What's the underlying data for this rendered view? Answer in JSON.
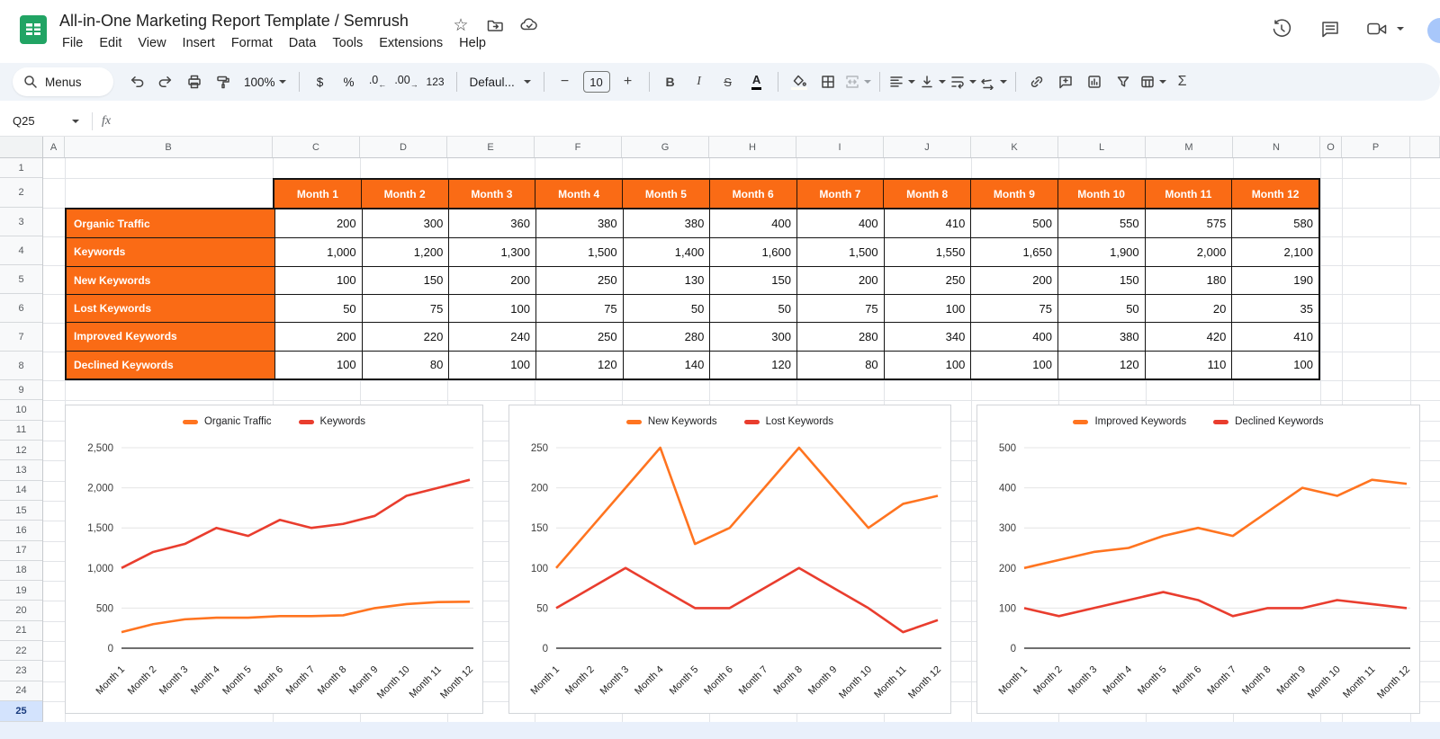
{
  "titlebar": {
    "title": "All-in-One Marketing Report Template / Semrush",
    "menus": [
      "File",
      "Edit",
      "View",
      "Insert",
      "Format",
      "Data",
      "Tools",
      "Extensions",
      "Help"
    ]
  },
  "toolbar": {
    "search_label": "Menus",
    "zoom_value": "100%",
    "format_currency": "$",
    "format_percent": "%",
    "decrease_decimal": ".0",
    "increase_decimal": ".00",
    "format_number": "123",
    "font_name": "Defaul...",
    "font_size": "10",
    "bold": "B",
    "italic": "I",
    "strikethrough": "S",
    "text_color": "A",
    "functions": "Σ"
  },
  "formula_bar": {
    "name_box": "Q25",
    "fx_label": "fx"
  },
  "grid": {
    "columns": [
      "A",
      "B",
      "C",
      "D",
      "E",
      "F",
      "G",
      "H",
      "I",
      "J",
      "K",
      "L",
      "M",
      "N",
      "O",
      "P"
    ],
    "rows": [
      "1",
      "2",
      "3",
      "4",
      "5",
      "6",
      "7",
      "8",
      "9",
      "10",
      "11",
      "12",
      "13",
      "14",
      "15",
      "16",
      "17",
      "18",
      "19",
      "20",
      "21",
      "22",
      "23",
      "24",
      "25"
    ],
    "selected_row": "25"
  },
  "table": {
    "months": [
      "Month 1",
      "Month 2",
      "Month 3",
      "Month 4",
      "Month 5",
      "Month 6",
      "Month 7",
      "Month 8",
      "Month 9",
      "Month 10",
      "Month 11",
      "Month 12"
    ],
    "rows": [
      {
        "label": "Organic Traffic",
        "values": [
          "200",
          "300",
          "360",
          "380",
          "380",
          "400",
          "400",
          "410",
          "500",
          "550",
          "575",
          "580"
        ]
      },
      {
        "label": "Keywords",
        "values": [
          "1,000",
          "1,200",
          "1,300",
          "1,500",
          "1,400",
          "1,600",
          "1,500",
          "1,550",
          "1,650",
          "1,900",
          "2,000",
          "2,100"
        ]
      },
      {
        "label": "New Keywords",
        "values": [
          "100",
          "150",
          "200",
          "250",
          "130",
          "150",
          "200",
          "250",
          "200",
          "150",
          "180",
          "190"
        ]
      },
      {
        "label": "Lost Keywords",
        "values": [
          "50",
          "75",
          "100",
          "75",
          "50",
          "50",
          "75",
          "100",
          "75",
          "50",
          "20",
          "35"
        ]
      },
      {
        "label": "Improved Keywords",
        "values": [
          "200",
          "220",
          "240",
          "250",
          "280",
          "300",
          "280",
          "340",
          "400",
          "380",
          "420",
          "410"
        ]
      },
      {
        "label": "Declined Keywords",
        "values": [
          "100",
          "80",
          "100",
          "120",
          "140",
          "120",
          "80",
          "100",
          "100",
          "120",
          "110",
          "100"
        ]
      }
    ]
  },
  "chart_data": [
    {
      "type": "line",
      "categories": [
        "Month 1",
        "Month 2",
        "Month 3",
        "Month 4",
        "Month 5",
        "Month 6",
        "Month 7",
        "Month 8",
        "Month 9",
        "Month 10",
        "Month 11",
        "Month 12"
      ],
      "series": [
        {
          "name": "Organic Traffic",
          "color": "#ff7420",
          "values": [
            200,
            300,
            360,
            380,
            380,
            400,
            400,
            410,
            500,
            550,
            575,
            580
          ]
        },
        {
          "name": "Keywords",
          "color": "#e93d2e",
          "values": [
            1000,
            1200,
            1300,
            1500,
            1400,
            1600,
            1500,
            1550,
            1650,
            1900,
            2000,
            2100
          ]
        }
      ],
      "ylim": [
        0,
        2500
      ],
      "yticks": [
        0,
        500,
        1000,
        1500,
        2000,
        2500
      ],
      "legend_position": "top",
      "grid": true,
      "title": "",
      "xlabel": "",
      "ylabel": ""
    },
    {
      "type": "line",
      "categories": [
        "Month 1",
        "Month 2",
        "Month 3",
        "Month 4",
        "Month 5",
        "Month 6",
        "Month 7",
        "Month 8",
        "Month 9",
        "Month 10",
        "Month 11",
        "Month 12"
      ],
      "series": [
        {
          "name": "New Keywords",
          "color": "#ff7420",
          "values": [
            100,
            150,
            200,
            250,
            130,
            150,
            200,
            250,
            200,
            150,
            180,
            190
          ]
        },
        {
          "name": "Lost Keywords",
          "color": "#e93d2e",
          "values": [
            50,
            75,
            100,
            75,
            50,
            50,
            75,
            100,
            75,
            50,
            20,
            35
          ]
        }
      ],
      "ylim": [
        0,
        250
      ],
      "yticks": [
        0,
        50,
        100,
        150,
        200,
        250
      ],
      "legend_position": "top",
      "grid": true,
      "title": "",
      "xlabel": "",
      "ylabel": ""
    },
    {
      "type": "line",
      "categories": [
        "Month 1",
        "Month 2",
        "Month 3",
        "Month 4",
        "Month 5",
        "Month 6",
        "Month 7",
        "Month 8",
        "Month 9",
        "Month 10",
        "Month 11",
        "Month 12"
      ],
      "series": [
        {
          "name": "Improved Keywords",
          "color": "#ff7420",
          "values": [
            200,
            220,
            240,
            250,
            280,
            300,
            280,
            340,
            400,
            380,
            420,
            410
          ]
        },
        {
          "name": "Declined Keywords",
          "color": "#e93d2e",
          "values": [
            100,
            80,
            100,
            120,
            140,
            120,
            80,
            100,
            100,
            120,
            110,
            100
          ]
        }
      ],
      "ylim": [
        0,
        500
      ],
      "yticks": [
        0,
        100,
        200,
        300,
        400,
        500
      ],
      "legend_position": "top",
      "grid": true,
      "title": "",
      "xlabel": "",
      "ylabel": ""
    }
  ],
  "colors": {
    "table_header": "#fa6b15",
    "line_orange": "#ff7420",
    "line_red": "#e93d2e",
    "toolbar_bg": "#f0f4f9",
    "selected_row_bg": "#d3e3fd",
    "sheets_green": "#21a464"
  }
}
